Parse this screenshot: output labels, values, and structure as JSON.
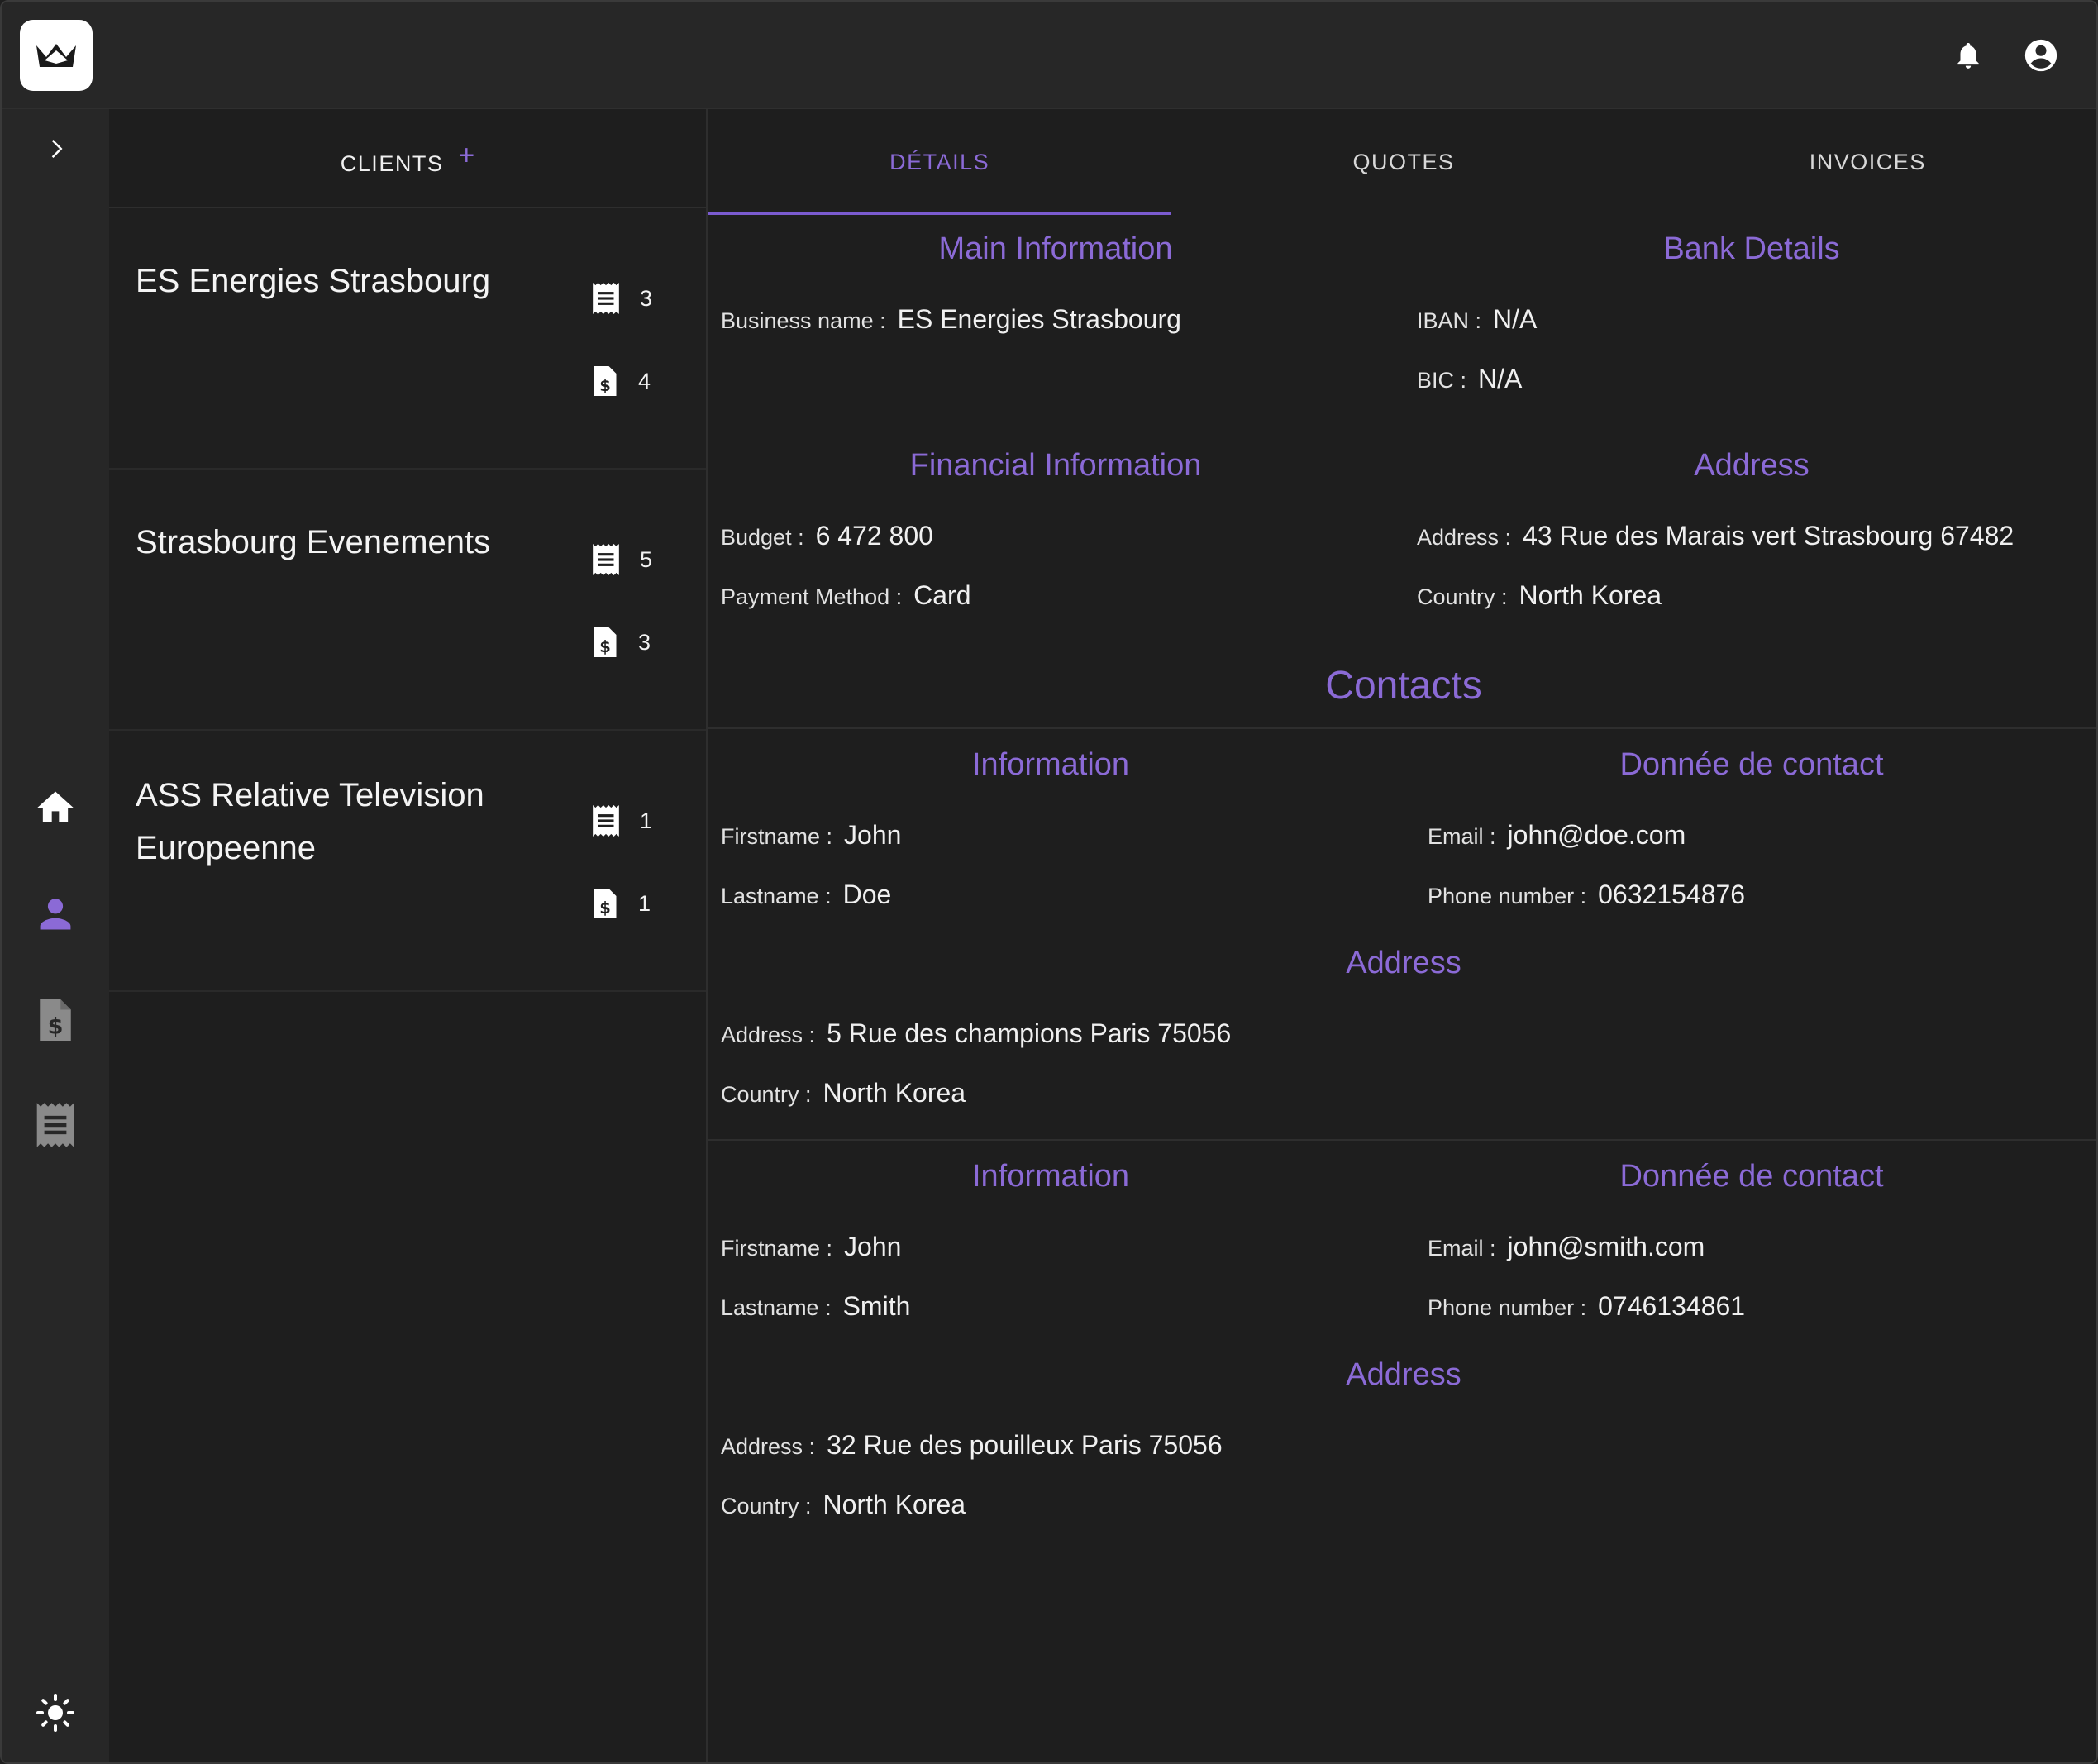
{
  "header": {
    "logo_icon": "crown-icon",
    "notifications_icon": "bell-icon",
    "account_icon": "account-circle-icon"
  },
  "rail": {
    "expand_icon": "chevron-right-icon",
    "items": [
      {
        "name": "home",
        "icon": "home-icon"
      },
      {
        "name": "clients",
        "icon": "person-icon",
        "active": true
      },
      {
        "name": "invoices",
        "icon": "invoice-dollar-icon"
      },
      {
        "name": "quotes",
        "icon": "receipt-icon"
      }
    ],
    "theme_icon": "sun-icon"
  },
  "clients": {
    "title": "CLIENTS",
    "add_label": "+",
    "items": [
      {
        "name": "ES Energies Strasbourg",
        "quotes": "3",
        "invoices": "4"
      },
      {
        "name": "Strasbourg Evenements",
        "quotes": "5",
        "invoices": "3"
      },
      {
        "name": "ASS Relative Television Europeenne",
        "quotes": "1",
        "invoices": "1"
      }
    ]
  },
  "tabs": [
    {
      "label": "DÉTAILS",
      "active": true
    },
    {
      "label": "QUOTES"
    },
    {
      "label": "INVOICES"
    }
  ],
  "details": {
    "main_information": {
      "title": "Main Information",
      "business_name_label": "Business name :",
      "business_name": "ES Energies Strasbourg"
    },
    "bank_details": {
      "title": "Bank Details",
      "iban_label": "IBAN :",
      "iban": "N/A",
      "bic_label": "BIC :",
      "bic": "N/A"
    },
    "financial_information": {
      "title": "Financial Information",
      "budget_label": "Budget :",
      "budget": "6 472 800",
      "payment_label": "Payment Method :",
      "payment": "Card"
    },
    "address": {
      "title": "Address",
      "address_label": "Address :",
      "address": "43 Rue des Marais vert Strasbourg 67482",
      "country_label": "Country :",
      "country": "North Korea"
    }
  },
  "contacts": {
    "title": "Contacts",
    "items": [
      {
        "info_title": "Information",
        "contact_title": "Donnée de contact",
        "address_title": "Address",
        "firstname_label": "Firstname :",
        "firstname": "John",
        "lastname_label": "Lastname :",
        "lastname": "Doe",
        "email_label": "Email :",
        "email": "john@doe.com",
        "phone_label": "Phone number :",
        "phone": "0632154876",
        "address_label": "Address :",
        "address": "5 Rue des champions Paris 75056",
        "country_label": "Country :",
        "country": "North Korea"
      },
      {
        "info_title": "Information",
        "contact_title": "Donnée de contact",
        "address_title": "Address",
        "firstname_label": "Firstname :",
        "firstname": "John",
        "lastname_label": "Lastname :",
        "lastname": "Smith",
        "email_label": "Email :",
        "email": "john@smith.com",
        "phone_label": "Phone number :",
        "phone": "0746134861",
        "address_label": "Address :",
        "address": "32 Rue des pouilleux Paris 75056",
        "country_label": "Country :",
        "country": "North Korea"
      }
    ]
  },
  "colors": {
    "accent": "#8b6ad6",
    "background": "#1e1e1e",
    "surface": "#272727"
  }
}
